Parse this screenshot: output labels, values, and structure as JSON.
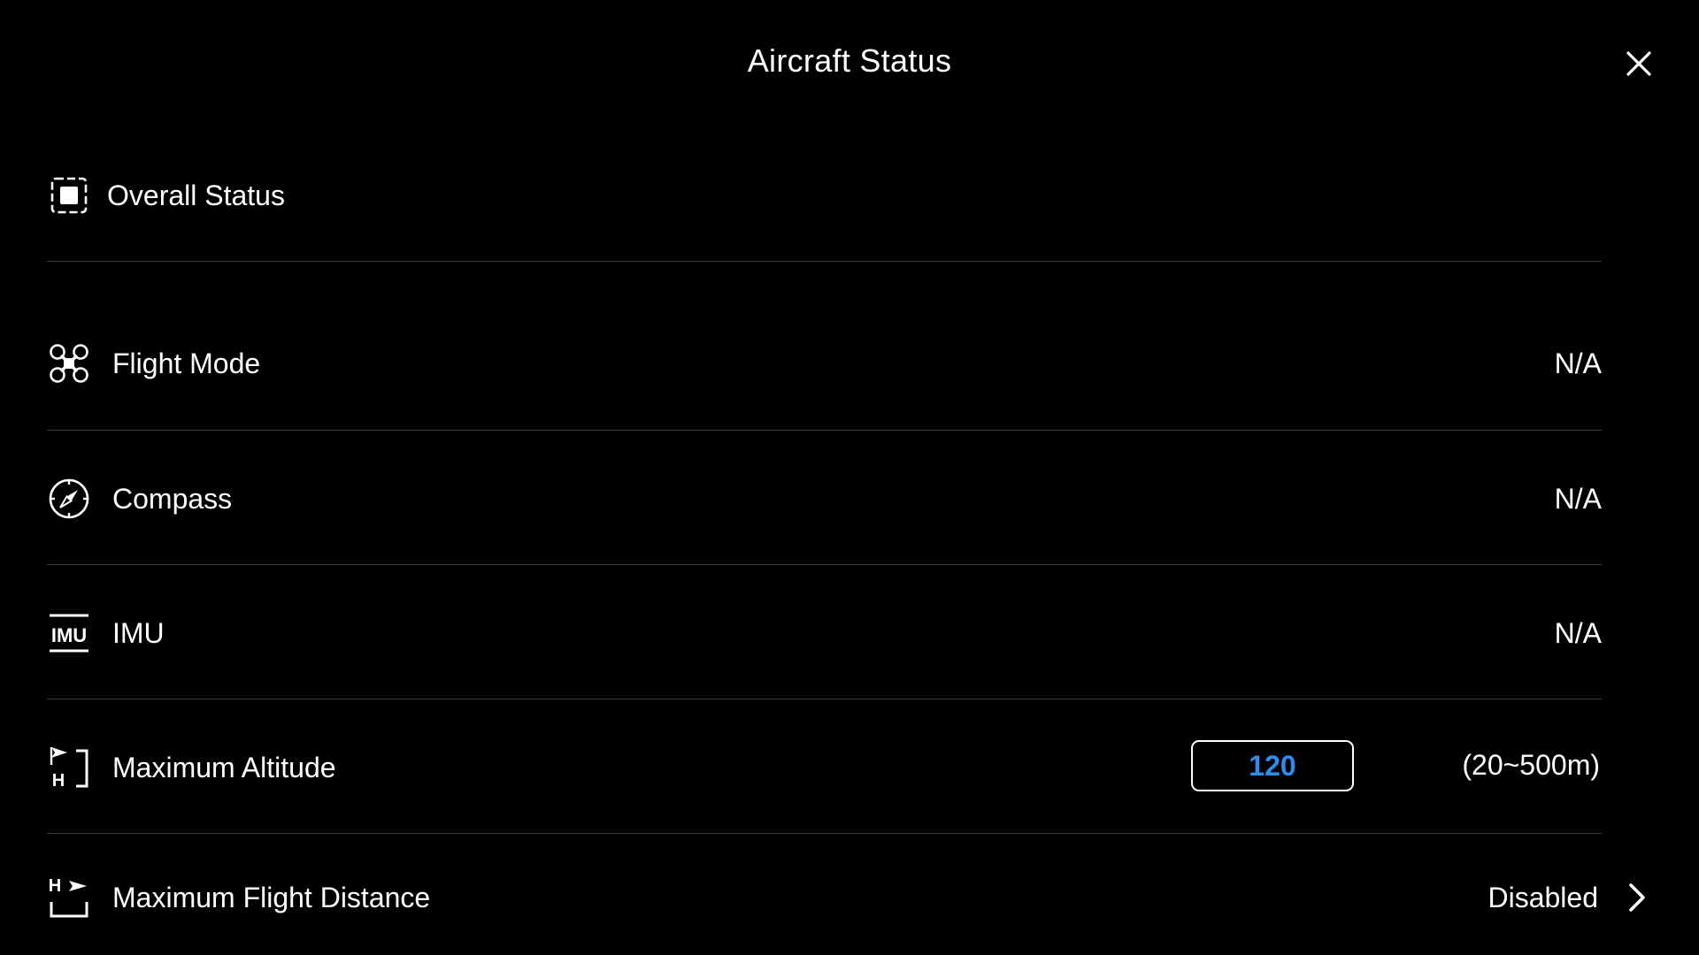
{
  "header": {
    "title": "Aircraft Status",
    "close_icon": "close-icon"
  },
  "rows": {
    "overall_status": {
      "label": "Overall Status",
      "icon": "overall-status-icon"
    },
    "flight_mode": {
      "label": "Flight Mode",
      "value": "N/A",
      "icon": "drone-icon"
    },
    "compass": {
      "label": "Compass",
      "value": "N/A",
      "icon": "compass-icon"
    },
    "imu": {
      "label": "IMU",
      "value": "N/A",
      "icon": "imu-icon"
    },
    "max_altitude": {
      "label": "Maximum Altitude",
      "input_value": "120",
      "range": "(20~500m)",
      "icon": "max-altitude-icon"
    },
    "max_flight_distance": {
      "label": "Maximum Flight Distance",
      "value": "Disabled",
      "icon": "max-distance-icon"
    }
  },
  "colors": {
    "background": "#000000",
    "text": "#ffffff",
    "accent": "#2d8ef0",
    "divider": "#3a3a3a"
  }
}
